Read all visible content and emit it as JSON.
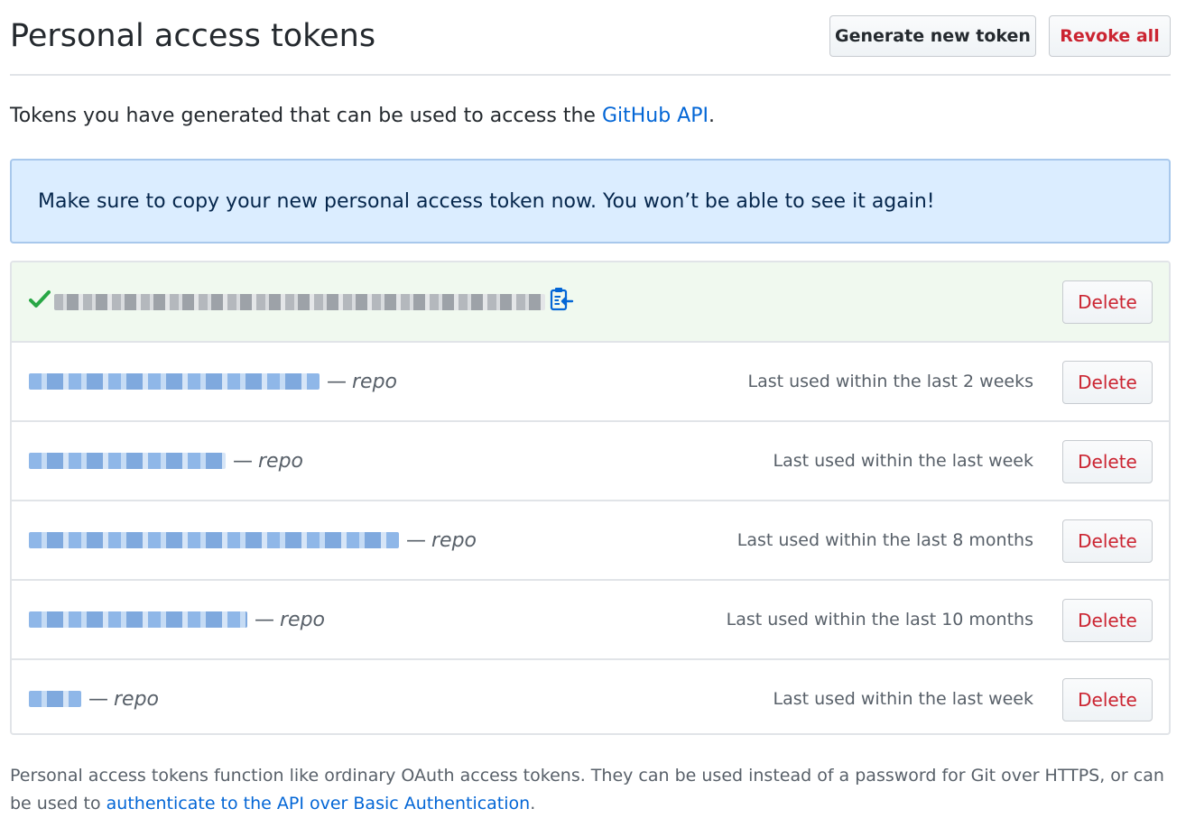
{
  "header": {
    "title": "Personal access tokens",
    "generate_label": "Generate new token",
    "revoke_label": "Revoke all"
  },
  "intro": {
    "text": "Tokens you have generated that can be used to access the ",
    "link": "GitHub API",
    "suffix": "."
  },
  "flash": {
    "message": "Make sure to copy your new personal access token now. You won’t be able to see it again!"
  },
  "new_token": {
    "delete_label": "Delete"
  },
  "tokens": [
    {
      "scope": "repo",
      "last_used": "Last used within the last 2 weeks",
      "delete_label": "Delete"
    },
    {
      "scope": "repo",
      "last_used": "Last used within the last week",
      "delete_label": "Delete"
    },
    {
      "scope": "repo",
      "last_used": "Last used within the last 8 months",
      "delete_label": "Delete"
    },
    {
      "scope": "repo",
      "last_used": "Last used within the last 10 months",
      "delete_label": "Delete"
    },
    {
      "scope": "repo",
      "last_used": "Last used within the last week",
      "delete_label": "Delete"
    }
  ],
  "footer": {
    "text": "Personal access tokens function like ordinary OAuth access tokens. They can be used instead of a password for Git over HTTPS, or can be used to ",
    "link": "authenticate to the API over Basic Authentication",
    "suffix": "."
  },
  "colors": {
    "link": "#0366d6",
    "danger": "#cb2431",
    "success": "#28a745",
    "flash_bg": "#dbedff",
    "new_token_bg": "#f0f9ef"
  },
  "icons": {
    "check": "check-icon",
    "clipboard": "clipboard-icon"
  }
}
